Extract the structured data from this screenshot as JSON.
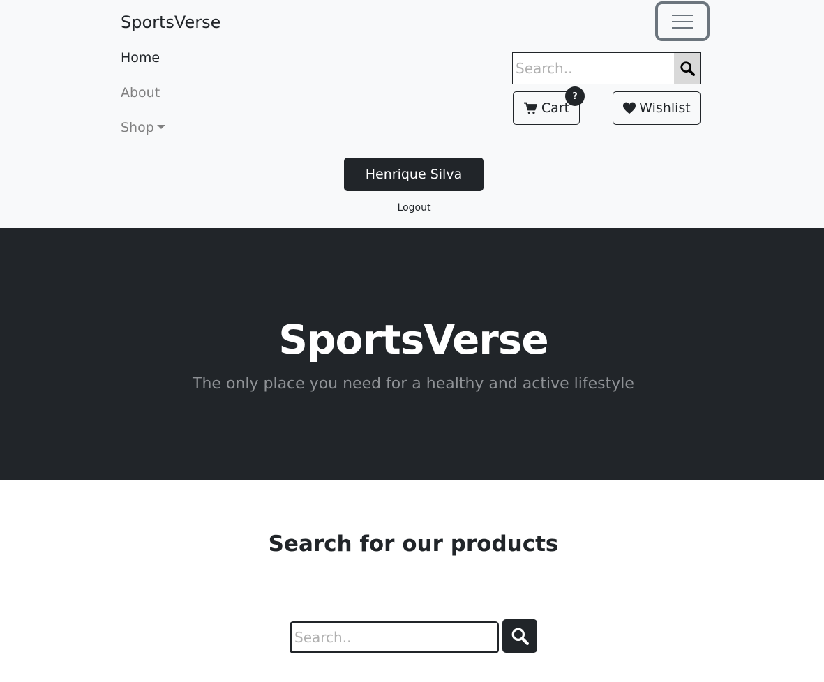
{
  "navbar": {
    "brand": "SportsVerse",
    "links": [
      {
        "label": "Home",
        "active": true
      },
      {
        "label": "About",
        "active": false
      },
      {
        "label": "Shop",
        "active": false
      }
    ],
    "search": {
      "placeholder": "Search.."
    },
    "cart": {
      "label": "Cart",
      "badge": "?"
    },
    "wishlist": {
      "label": "Wishlist"
    },
    "user": {
      "name": "Henrique Silva",
      "logout": "Logout"
    }
  },
  "hero": {
    "title": "SportsVerse",
    "subtitle": "The only place you need for a healthy and active lifestyle"
  },
  "product_search": {
    "title": "Search for our products",
    "placeholder": "Search.."
  },
  "icons": {
    "toggler": "hamburger-icon",
    "search": "search-icon",
    "cart": "cart-icon",
    "wishlist": "heart-icon",
    "dropdown": "caret-down-icon"
  },
  "colors": {
    "dark": "#212529",
    "light": "#f8f9fa",
    "muted": "#808080"
  }
}
